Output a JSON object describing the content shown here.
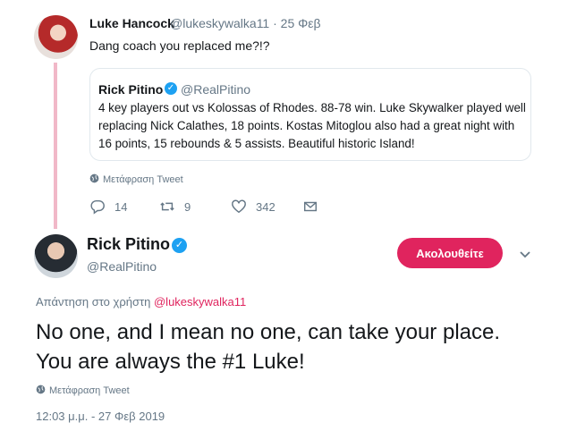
{
  "reply_tweet": {
    "name": "Luke Hancock",
    "handle": "@lukeskywalka11",
    "date": "· 25 Φεβ",
    "text": "Dang coach you replaced me?!?",
    "translate_label": "Μετάφραση Tweet",
    "stats": {
      "replies": "14",
      "retweets": "9",
      "likes": "342"
    },
    "quoted": {
      "name": "Rick Pitino",
      "handle": "@RealPitino",
      "text": "4 key players out vs Kolossas of Rhodes. 88-78 win. Luke Skywalker played well replacing Nick Calathes, 18 points. Kostas Mitoglou also had a great night with 16 points, 15 rebounds & 5 assists. Beautiful historic Island!"
    }
  },
  "main_tweet": {
    "name": "Rick Pitino",
    "handle": "@RealPitino",
    "follow_label": "Ακολουθείτε",
    "reply_to_prefix": "Απάντηση στο χρήστη",
    "reply_to_handle": "@lukeskywalka11",
    "text": "No one, and I mean no one, can take your place. You are always the #1 Luke!",
    "translate_label": "Μετάφραση Tweet",
    "timestamp": "12:03 μ.μ. - 27 Φεβ 2019"
  },
  "colors": {
    "accent": "#e0245e",
    "verified": "#1da1f2",
    "muted": "#657786",
    "thread": "#f1b8c8"
  }
}
